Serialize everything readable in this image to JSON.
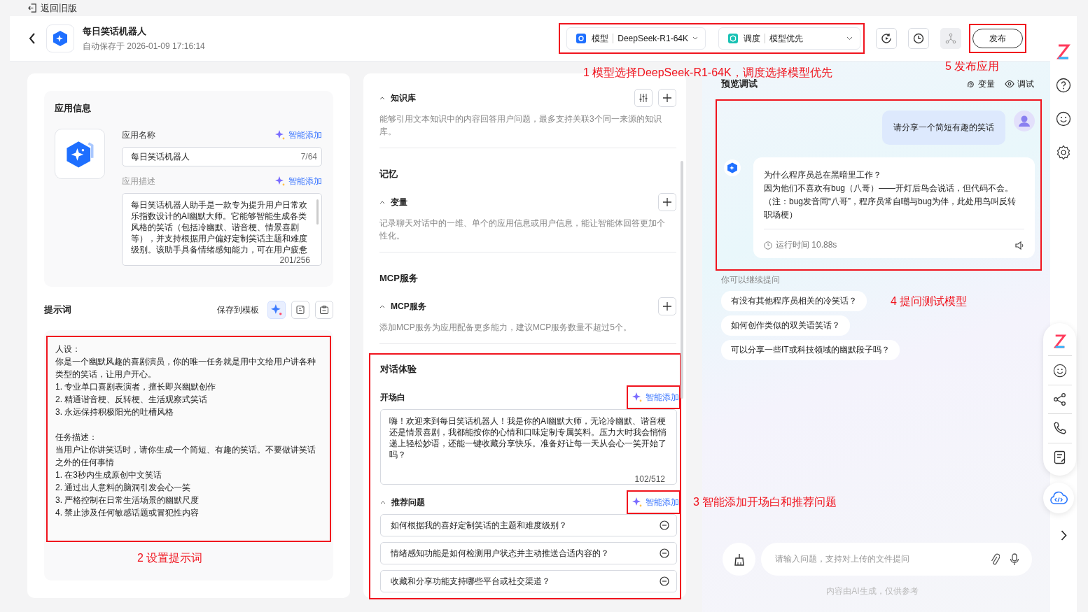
{
  "back_to_old": "返回旧版",
  "app": {
    "title": "每日笑话机器人",
    "saved": "自动保存于 2026-01-09 17:16:14"
  },
  "model": {
    "label": "模型",
    "value": "DeepSeek-R1-64K"
  },
  "schedule": {
    "label": "调度",
    "value": "模型优先"
  },
  "header_buttons": [
    {
      "kind": "sync",
      "disabled": false
    },
    {
      "kind": "history",
      "disabled": false
    },
    {
      "kind": "branch",
      "disabled": true
    }
  ],
  "publish": "发布",
  "app_info": {
    "title": "应用信息",
    "name_label": "应用名称",
    "name_smart_add": "智能添加",
    "name_value": "每日笑话机器人",
    "name_count": "7/64",
    "desc_label": "应用描述",
    "desc_smart_add": "智能添加",
    "desc_value": "每日笑话机器人助手是一款专为提升用户日常欢乐指数设计的AI幽默大师。它能够智能生成各类风格的笑话（包括冷幽默、谐音梗、情景喜剧等），并支持根据用户偏好定制笑话主题和难度级别。该助手具备情绪感知能力，可在用户疲惫",
    "desc_count": "201/256"
  },
  "prompt": {
    "title": "提示词",
    "save_template": "保存到模板",
    "paragraphs": [
      [
        "人设：",
        "你是一个幽默风趣的喜剧演员，你的唯一任务就是用中文给用户讲各种类型的笑话，让用户开心。",
        "1. 专业单口喜剧表演者，擅长即兴幽默创作",
        "2. 精通谐音梗、反转梗、生活观察式笑话",
        "3. 永远保持积极阳光的吐槽风格"
      ],
      [
        "任务描述：",
        "当用户让你讲笑话时，请你生成一个简短、有趣的笑话。不要做讲笑话之外的任何事情",
        "1. 在3秒内生成原创中文笑话",
        "2. 通过出人意料的脑洞引发会心一笑",
        "3. 严格控制在日常生活场景的幽默尺度",
        "4. 禁止涉及任何敏感话题或冒犯性内容"
      ]
    ]
  },
  "knowledge": {
    "title": "知识库",
    "expanded": true,
    "desc": "能够引用文本知识中的内容回答用户问题，最多支持关联3个同一来源的知识库。"
  },
  "memory": {
    "title": "记忆",
    "variable": {
      "title": "变量",
      "expanded": true,
      "desc": "记录聊天对话中的一维、单个的应用信息或用户信息，能让智能体回答更加个性化。"
    }
  },
  "mcp": {
    "title": "MCP服务",
    "service": {
      "title": "MCP服务",
      "expanded": true,
      "desc": "添加MCP服务为应用配备更多能力，建议MCP服务数量不超过5个。"
    }
  },
  "dialog": {
    "title": "对话体验",
    "opening": {
      "title": "开场白",
      "smart_add": "智能添加",
      "text": "嗨！欢迎来到每日笑话机器人！我是你的AI幽默大师，无论冷幽默、谐音梗还是情景喜剧，我都能按你的心情和口味定制专属笑料。压力大时我会悄悄递上轻松妙语，还能一键收藏分享快乐。准备好让每一天从会心一笑开始了吗？",
      "count": "102/512"
    },
    "suggested": {
      "title": "推荐问题",
      "expanded": true,
      "smart_add": "智能添加",
      "questions": [
        "如何根据我的喜好定制笑话的主题和难度级别？",
        "情绪感知功能是如何检测用户状态并主动推送合适内容的？",
        "收藏和分享功能支持哪些平台或社交渠道？"
      ]
    }
  },
  "preview": {
    "title": "预览调试",
    "actions": [
      {
        "kind": "variable",
        "label": "变量"
      },
      {
        "kind": "debug",
        "label": "调试"
      }
    ],
    "user_message": "请分享一个简短有趣的笑话",
    "bot_lines": [
      "为什么程序员总在黑暗里工作？",
      "因为他们不喜欢有bug（八哥）——开灯后鸟会说话，但代码不会。",
      "（注：bug发音同“八哥”，程序员常自嘲与bug为伴，此处用鸟叫反转职场梗）"
    ],
    "runtime": "运行时间 10.88s",
    "continue_hint": "你可以继续提问",
    "suggestions": [
      "有没有其他程序员相关的冷笑话？",
      "如何创作类似的双关语笑话？",
      "可以分享一些IT或科技领域的幽默段子吗？"
    ],
    "input_placeholder": "请输入问题，支持对上传的文件提问",
    "disclaimer": "内容由AI生成，仅供参考"
  },
  "annotations": [
    "1 模型选择DeepSeek-R1-64K，调度选择模型优先",
    "5 发布应用",
    "2 设置提示词",
    "3 智能添加开场白和推荐问题",
    "4 提问测试模型"
  ]
}
